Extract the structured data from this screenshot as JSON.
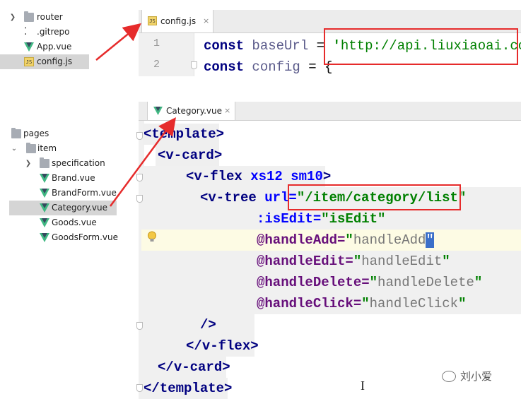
{
  "tree_top": {
    "items": [
      {
        "label": "router",
        "kind": "folder",
        "expandable": true
      },
      {
        "label": ".gitrepo",
        "kind": "file"
      },
      {
        "label": "App.vue",
        "kind": "vue"
      },
      {
        "label": "config.js",
        "kind": "js",
        "selected": true
      }
    ]
  },
  "tree_bottom": {
    "items": [
      {
        "label": "pages",
        "kind": "folder"
      },
      {
        "label": "item",
        "kind": "folder",
        "expanded": true
      },
      {
        "label": "specification",
        "kind": "folder",
        "expandable": true
      },
      {
        "label": "Brand.vue",
        "kind": "vue"
      },
      {
        "label": "BrandForm.vue",
        "kind": "vue"
      },
      {
        "label": "Category.vue",
        "kind": "vue",
        "selected": true
      },
      {
        "label": "Goods.vue",
        "kind": "vue"
      },
      {
        "label": "GoodsForm.vue",
        "kind": "vue"
      }
    ]
  },
  "editor_top": {
    "tab": {
      "label": "config.js",
      "close": "×"
    },
    "line_numbers": [
      "1",
      "2"
    ],
    "line1": {
      "kw": "const",
      "ident": "baseUrl",
      "eq": " = ",
      "quote": "'",
      "url": "http://api.liuxiaoai.com"
    },
    "line2": {
      "kw": "const",
      "ident": "config",
      "rest": " = {"
    }
  },
  "editor_bottom": {
    "tab": {
      "label": "Category.vue",
      "close": "×"
    },
    "lines": {
      "l1": {
        "open": "<",
        "tag": "template",
        "close": ">"
      },
      "l2": {
        "open": "<",
        "tag": "v-card",
        "close": ">"
      },
      "l3": {
        "open": "<",
        "tag": "v-flex",
        "a1": " xs12",
        "a2": " sm10",
        "close": ">"
      },
      "l4": {
        "open": "<",
        "tag": "v-tree",
        "attr": " url=",
        "value": "\"/item/category/list\""
      },
      "l5": {
        "attr": ":isEdit=",
        "q1": "\"",
        "value": "isEdit",
        "q2": "\""
      },
      "l6": {
        "attr": "@handleAdd=",
        "q1": "\"",
        "value": "handleAdd",
        "q2": "\""
      },
      "l7": {
        "attr": "@handleEdit=",
        "q1": "\"",
        "value": "handleEdit",
        "q2": "\""
      },
      "l8": {
        "attr": "@handleDelete=",
        "q1": "\"",
        "value": "handleDelete",
        "q2": "\""
      },
      "l9": {
        "attr": "@handleClick=",
        "q1": "\"",
        "value": "handleClick",
        "q2": "\""
      },
      "l10": {
        "text": "/>"
      },
      "l11": {
        "open": "</",
        "tag": "v-flex",
        "close": ">"
      },
      "l12": {
        "open": "</",
        "tag": "v-card",
        "close": ">"
      },
      "l13": {
        "open": "</",
        "tag": "template",
        "close": ">"
      }
    }
  },
  "watermark": {
    "text": "刘小爱"
  },
  "colors": {
    "annotation": "#e62b2b",
    "vue_green": "#41b883",
    "selection": "#d5d5d5"
  }
}
